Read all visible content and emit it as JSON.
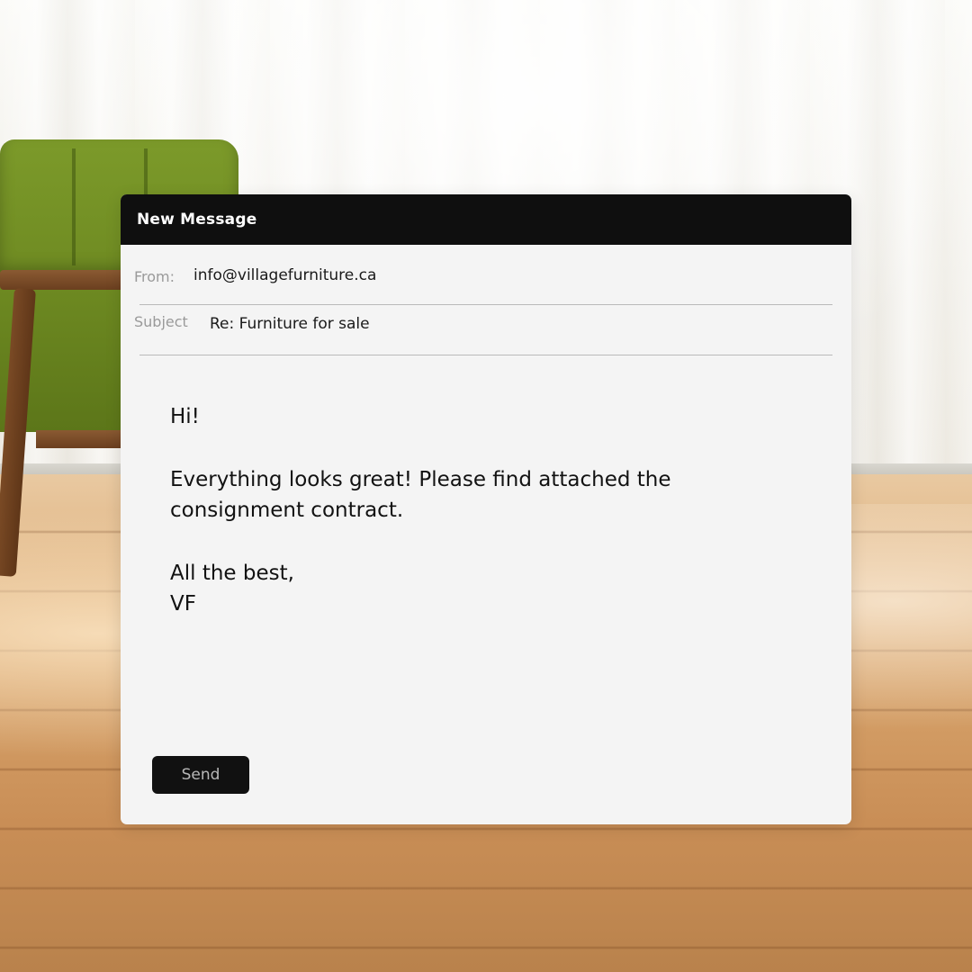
{
  "window": {
    "title": "New Message"
  },
  "fields": {
    "from_label": "From:",
    "from_value": "info@villagefurniture.ca",
    "subject_label": "Subject",
    "subject_value": "Re: Furniture for sale"
  },
  "body": {
    "greeting": "Hi!",
    "message_line1": "Everything looks great! Please find attached the",
    "message_line2": "consignment contract.",
    "signoff": "All the best,",
    "signature": "VF"
  },
  "actions": {
    "send_label": "Send"
  },
  "colors": {
    "titlebar": "#0f0f0f",
    "window_bg": "#f4f4f4",
    "button_bg": "#111111",
    "label_gray": "#9a9a9a",
    "chair_green": "#7c9a2a",
    "floor_wood": "#d9a66e"
  }
}
